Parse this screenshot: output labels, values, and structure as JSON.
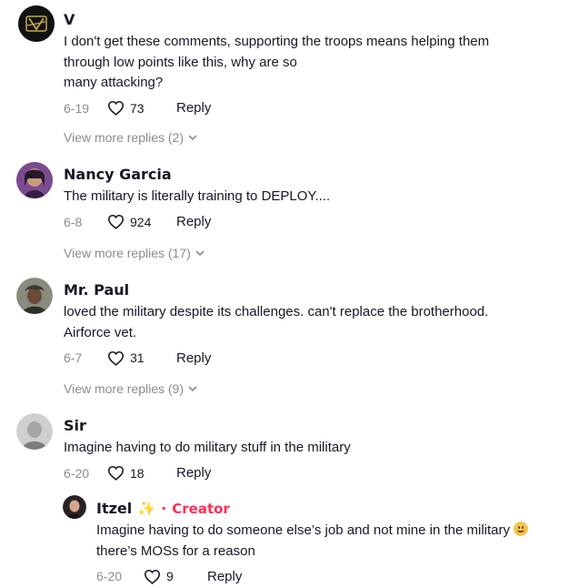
{
  "comments": [
    {
      "username": "V",
      "text": "I don't get these comments, supporting the troops means helping them\nthrough low points like this, why are so\nmany attacking?",
      "date": "6-19",
      "likes": "73",
      "reply_label": "Reply",
      "view_more": "View more replies (2)"
    },
    {
      "username": "Nancy Garcia",
      "text": "The military is literally training to DEPLOY....",
      "date": "6-8",
      "likes": "924",
      "reply_label": "Reply",
      "view_more": "View more replies (17)"
    },
    {
      "username": "Mr. Paul",
      "text": "loved the military despite its challenges. can't replace the brotherhood.\nAirforce vet.",
      "date": "6-7",
      "likes": "31",
      "reply_label": "Reply",
      "view_more": "View more replies (9)"
    },
    {
      "username": "Sir",
      "text": "Imagine having to do military stuff in the military",
      "date": "6-20",
      "likes": "18",
      "reply_label": "Reply"
    }
  ],
  "reply": {
    "username": "Itzel",
    "sparkle": "✨",
    "separator": "·",
    "badge": "Creator",
    "text_line1": "Imagine having to do someone else’s job and not mine in the military",
    "text_line2": "there’s MOSs for a reason",
    "date": "6-20",
    "likes": "9",
    "reply_label": "Reply"
  },
  "icons": {
    "heart": "heart-outline-icon",
    "chevron": "chevron-down-icon",
    "emoji": "smiling-face-emoji"
  }
}
